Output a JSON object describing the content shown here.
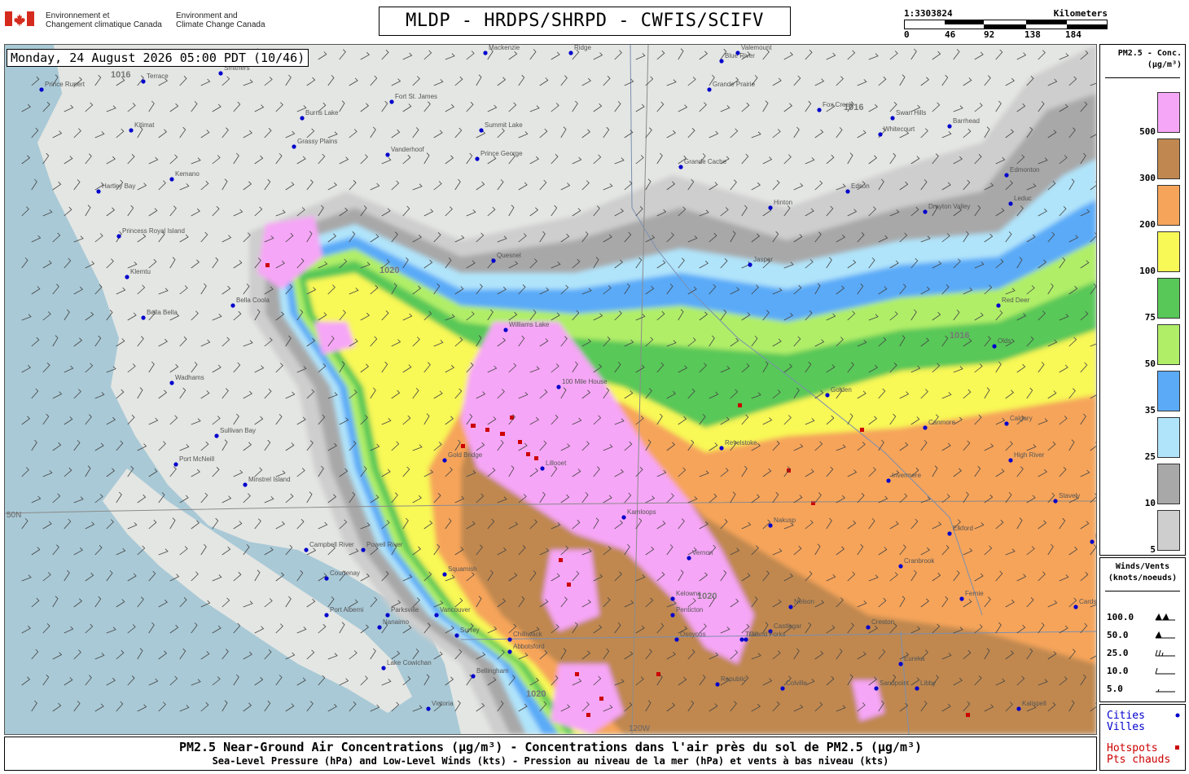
{
  "header": {
    "dept_fr_line1": "Environnement et",
    "dept_fr_line2": "Changement climatique Canada",
    "dept_en_line1": "Environment and",
    "dept_en_line2": "Climate Change Canada",
    "title": "MLDP - HRDPS/SHRPD - CWFIS/SCIFV",
    "scale_ratio": "1:3303824",
    "scale_unit": "Kilometers",
    "scale_ticks": [
      "0",
      "46",
      "92",
      "138",
      "184"
    ]
  },
  "datetime": "Monday, 24 August 2026 05:00 PDT (10/46)",
  "legend_pm": {
    "title_line1": "PM2.5 - Conc.",
    "title_line2": "(μg/m³)",
    "bins": [
      {
        "label": "500",
        "color": "#f6a6f6"
      },
      {
        "label": "300",
        "color": "#c08850"
      },
      {
        "label": "200",
        "color": "#f6a45a"
      },
      {
        "label": "100",
        "color": "#f8f856"
      },
      {
        "label": "75",
        "color": "#58c858"
      },
      {
        "label": "50",
        "color": "#b0ee68"
      },
      {
        "label": "35",
        "color": "#5aaaf8"
      },
      {
        "label": "25",
        "color": "#b0e4fa"
      },
      {
        "label": "10",
        "color": "#a8a8a8"
      },
      {
        "label": "5",
        "color": "#cecece"
      }
    ]
  },
  "legend_wind": {
    "title_line1": "Winds/Vents",
    "title_line2": "(knots/noeuds)",
    "rows": [
      "100.0",
      "50.0",
      "25.0",
      "10.0",
      "5.0"
    ]
  },
  "legend_points": {
    "cities_en": "Cities",
    "cities_fr": "Villes",
    "hotspots_en": "Hotspots",
    "hotspots_fr": "Pts chauds",
    "city_color": "#0000cc",
    "hotspot_color": "#cc0000"
  },
  "footer": {
    "line1": "PM2.5 Near-Ground Air Concentrations (μg/m³) - Concentrations dans l'air près du sol de PM2.5 (μg/m³)",
    "line2": "Sea-Level Pressure (hPa) and Low-Level Winds (kts) - Pression au niveau de la mer (hPa) et vents à bas niveau (kts)"
  },
  "map": {
    "grid_labels": {
      "lat": "50N",
      "lon": "120W"
    },
    "isobars": [
      "1020",
      "1016"
    ],
    "places": [
      "Prince Rupert",
      "Terrace",
      "Hazelton",
      "Smithers",
      "Fort St. James",
      "Burns Lake",
      "Kitimat",
      "Vanderhoof",
      "Prince George",
      "Summit Lake",
      "Grassy Plains",
      "Kemano",
      "Hartley Bay",
      "Princess Royal Island",
      "Klemtu",
      "Bella Coola",
      "Bella Bella",
      "Quesnel",
      "Williams Lake",
      "Wadhams",
      "100 Mile House",
      "Sullivan Bay",
      "Port McNeill",
      "Minstrel Island",
      "Gold Bridge",
      "Kamloops",
      "Vernon",
      "Kelowna",
      "Penticton",
      "Campbell River",
      "Powell River",
      "Courtenay",
      "Squamish",
      "Port Alberni",
      "Parksville",
      "Nanaimo",
      "Vancouver",
      "Surrey",
      "Chilliwack",
      "Abbotsford",
      "Bellingham",
      "Lake Cowichan",
      "Victoria",
      "Grande Cache",
      "Grande Prairie",
      "Swan Hills",
      "Fox Creek",
      "Whitecourt",
      "Barrhead",
      "Edson",
      "Drayton Valley",
      "Hinton",
      "Jasper",
      "Edmonton",
      "Leduc",
      "Red Deer",
      "Olds",
      "Canmore",
      "Calgary",
      "High River",
      "Golden",
      "Revelstoke",
      "Nakusp",
      "Invermere",
      "Cranbrook",
      "Elkford",
      "Fernie",
      "Creston",
      "Nelson",
      "Castlegar",
      "Trail",
      "Grand Forks",
      "Osoyoos",
      "Republic",
      "Colville",
      "Sandpoint",
      "Libby",
      "Eureka",
      "Kalispell",
      "Cardston",
      "Lethbridge",
      "Stavely",
      "Lillooet",
      "Mackenzie",
      "Valemount",
      "Blue River",
      "Ridge"
    ]
  }
}
